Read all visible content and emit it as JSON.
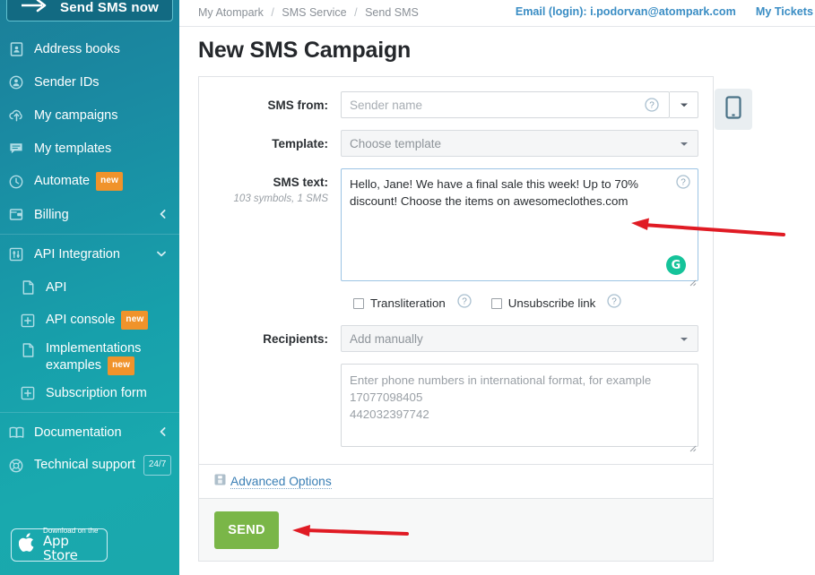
{
  "sidebar": {
    "cta": {
      "label": "Send SMS now",
      "icon": "arrow-right-icon"
    },
    "items": [
      {
        "id": "address-books",
        "label": "Address books",
        "icon": "address-book-icon",
        "badge": null,
        "caret": null,
        "sub": false
      },
      {
        "id": "sender-ids",
        "label": "Sender IDs",
        "icon": "user-circle-icon",
        "badge": null,
        "caret": null,
        "sub": false
      },
      {
        "id": "my-campaigns",
        "label": "My campaigns",
        "icon": "upload-cloud-icon",
        "badge": null,
        "caret": null,
        "sub": false
      },
      {
        "id": "my-templates",
        "label": "My templates",
        "icon": "speech-bubble-icon",
        "badge": null,
        "caret": null,
        "sub": false
      },
      {
        "id": "automate",
        "label": "Automate",
        "icon": "clock-icon",
        "badge": "new",
        "caret": null,
        "sub": false
      },
      {
        "id": "billing",
        "label": "Billing",
        "icon": "wallet-icon",
        "badge": null,
        "caret": "left",
        "sub": false
      },
      {
        "id": "api-integration",
        "label": "API Integration",
        "icon": "sliders-icon",
        "badge": null,
        "caret": "down",
        "sub": false
      },
      {
        "id": "api",
        "label": "API",
        "icon": "file-icon",
        "badge": null,
        "caret": null,
        "sub": true
      },
      {
        "id": "api-console",
        "label": "API console",
        "icon": "window-plus-icon",
        "badge": "new",
        "caret": null,
        "sub": true
      },
      {
        "id": "implementations-examples",
        "label": "Implementations examples",
        "icon": "file-icon",
        "badge": "new",
        "caret": null,
        "sub": true
      },
      {
        "id": "subscription-form",
        "label": "Subscription form",
        "icon": "window-plus-icon",
        "badge": null,
        "caret": null,
        "sub": true
      },
      {
        "id": "documentation",
        "label": "Documentation",
        "icon": "book-icon",
        "badge": null,
        "caret": "left",
        "sub": false
      },
      {
        "id": "technical-support",
        "label": "Technical support",
        "icon": "lifebuoy-icon",
        "badge": "24/7",
        "caret": null,
        "sub": false
      }
    ],
    "appstore": {
      "small": "Download on the",
      "big": "App Store",
      "icon": "apple-icon"
    }
  },
  "header": {
    "breadcrumb": {
      "items": [
        "My Atompark",
        "SMS Service",
        "Send SMS"
      ],
      "separator": "/"
    },
    "email_login": "Email (login): i.podorvan@atompark.com",
    "my_tickets": "My Tickets"
  },
  "page": {
    "title": "New SMS Campaign"
  },
  "form": {
    "sms_from": {
      "label": "SMS from:",
      "value": "",
      "placeholder": "Sender name",
      "help_icon": "question-circle-icon",
      "caret_icon": "chevron-down-icon"
    },
    "template": {
      "label": "Template:",
      "value": "Choose template",
      "caret_icon": "chevron-down-icon"
    },
    "sms_text": {
      "label": "SMS text:",
      "counter": "103 symbols, 1 SMS",
      "value": "Hello, Jane! We have a final sale this week! Up to 70% discount! Choose the items on awesomeclothes.com",
      "help_icon": "question-circle-icon",
      "grammarly_icon": "G"
    },
    "transliteration": {
      "label": "Transliteration",
      "checked": false,
      "help_icon": "question-circle-icon"
    },
    "unsubscribe_link": {
      "label": "Unsubscribe link",
      "checked": false,
      "help_icon": "question-circle-icon"
    },
    "recipients": {
      "label": "Recipients:",
      "value": "Add manually",
      "caret_icon": "chevron-down-icon"
    },
    "phones": {
      "value": "",
      "placeholder": "Enter phone numbers in international format, for example\n17077098405\n442032397742"
    },
    "advanced_options": {
      "label": "Advanced Options",
      "icon": "panel-icon"
    },
    "send_button": {
      "label": "SEND"
    },
    "preview_tab": {
      "icon": "mobile-phone-icon"
    }
  },
  "annotations": {
    "arrows": [
      {
        "name": "arrow-to-sms-text",
        "color": "#e01b24"
      },
      {
        "name": "arrow-to-send-button",
        "color": "#e01b24"
      }
    ]
  },
  "colors": {
    "sidebar_top": "#1b7f99",
    "sidebar_bottom": "#1aa8ac",
    "link_blue": "#3a8dc4",
    "send_green": "#7ab648",
    "badge_orange": "#f0932b",
    "grammarly_green": "#15c39a",
    "annotation_red": "#e01b24"
  }
}
